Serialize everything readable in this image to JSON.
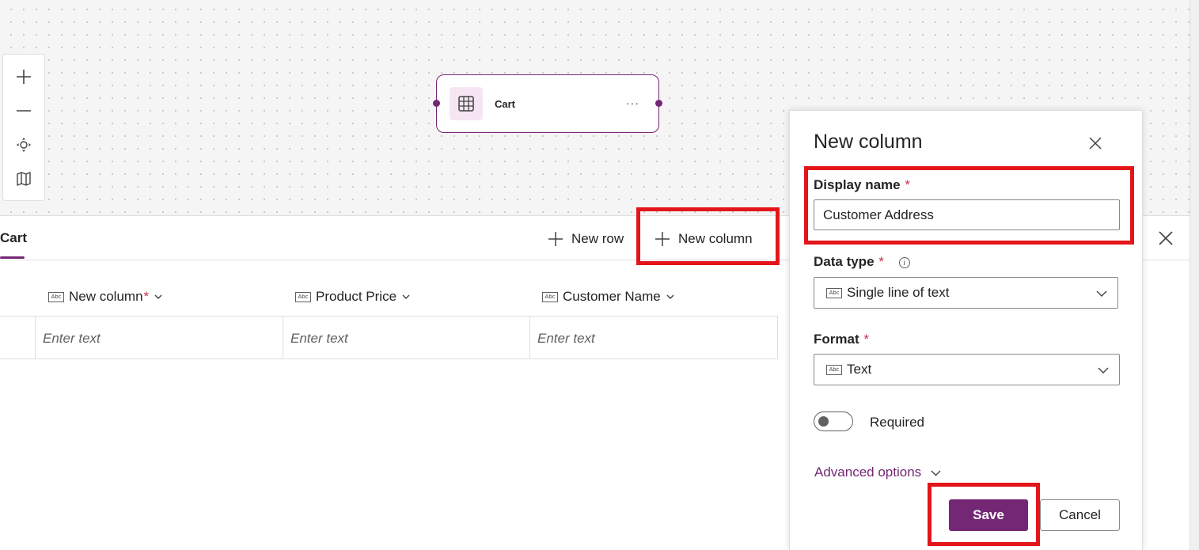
{
  "canvas": {
    "table_node": {
      "title": "Cart",
      "more_label": "···"
    }
  },
  "zoom_controls": {
    "zoom_in_icon": "plus-icon",
    "zoom_out_icon": "minus-icon",
    "fit_icon": "fit-view-icon",
    "map_icon": "minimap-icon"
  },
  "grid": {
    "tab_label": "Cart",
    "new_row_label": "New row",
    "new_column_label": "New column",
    "columns": [
      {
        "label": "New column",
        "required": "*",
        "placeholder": "Enter text"
      },
      {
        "label": "Product Price",
        "placeholder": "Enter text"
      },
      {
        "label": "Customer Name",
        "placeholder": "Enter text"
      }
    ],
    "type_badge": "Abc"
  },
  "panel": {
    "title": "New column",
    "display_name_label": "Display name",
    "display_name_value": "Customer Address",
    "required_marker": "*",
    "data_type_label": "Data type",
    "data_type_value": "Single line of text",
    "format_label": "Format",
    "format_value": "Text",
    "required_toggle_label": "Required",
    "required_toggle_on": false,
    "advanced_label": "Advanced options",
    "save_label": "Save",
    "cancel_label": "Cancel"
  },
  "colors": {
    "accent": "#742774",
    "highlight": "#e3151a",
    "required": "#c4314b"
  }
}
